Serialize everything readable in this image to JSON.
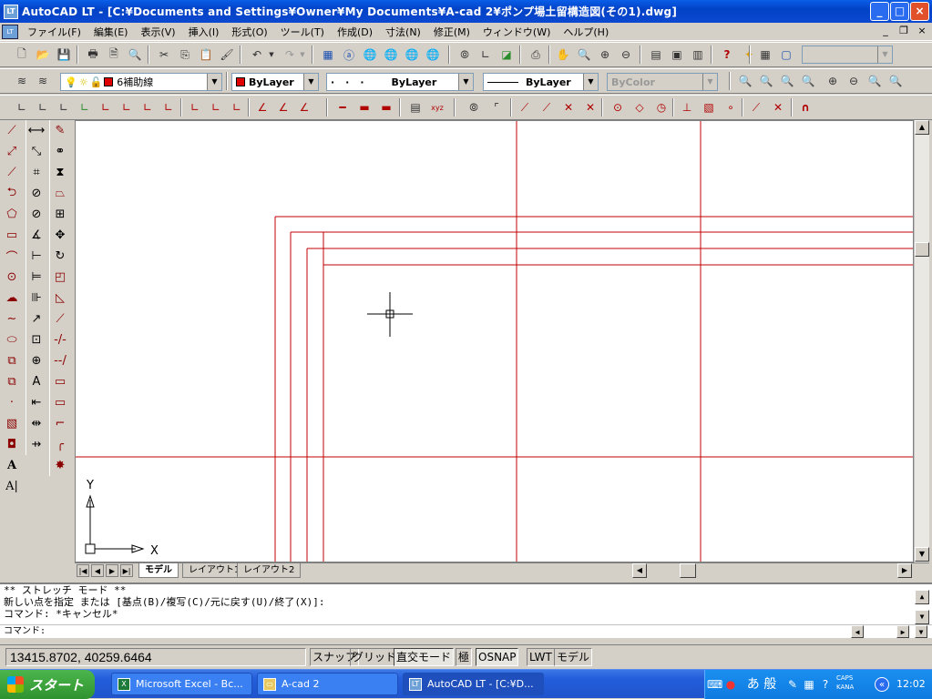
{
  "window": {
    "title": "AutoCAD LT - [C:¥Documents and Settings¥Owner¥My Documents¥A-cad 2¥ポンプ場土留構造図(その1).dwg]",
    "app_icon": "LT",
    "minimize": "_",
    "maximize": "□",
    "close": "×"
  },
  "menu": {
    "items": [
      "ファイル(F)",
      "編集(E)",
      "表示(V)",
      "挿入(I)",
      "形式(O)",
      "ツール(T)",
      "作成(D)",
      "寸法(N)",
      "修正(M)",
      "ウィンドウ(W)",
      "ヘルプ(H)"
    ],
    "mdi_min": "_",
    "mdi_restore": "❐",
    "mdi_close": "×"
  },
  "layers": {
    "current_layer": "6補助線",
    "color": "ByLayer",
    "linetype": "ByLayer",
    "lineweight": "ByLayer",
    "plotstyle": "ByColor",
    "layer_color": "#e00000"
  },
  "canvas": {
    "ucs_x": "X",
    "ucs_y": "Y",
    "line_color": "#c00000"
  },
  "tabs": {
    "items": [
      "モデル",
      "レイアウト1",
      "レイアウト2"
    ],
    "active": 0
  },
  "command": {
    "lines": [
      "** ストレッチ モード **",
      "新しい点を指定 または [基点(B)/複写(C)/元に戻す(U)/終了(X)]:",
      "コマンド: *キャンセル*"
    ],
    "prompt": "コマンド:"
  },
  "status": {
    "coords": "13415.8702, 40259.6464",
    "buttons": [
      "スナップ",
      "グリッド",
      "直交モード",
      "極",
      "OSNAP",
      "LWT",
      "モデル"
    ]
  },
  "taskbar": {
    "start": "スタート",
    "tasks": [
      {
        "label": "Microsoft Excel - Bc...",
        "icon": "X"
      },
      {
        "label": "A-cad 2",
        "icon": "▭"
      },
      {
        "label": "AutoCAD LT - [C:¥D...",
        "icon": "LT"
      }
    ],
    "ime": "あ 般",
    "caps": "CAPS",
    "kana": "KANA",
    "clock": "12:02"
  }
}
